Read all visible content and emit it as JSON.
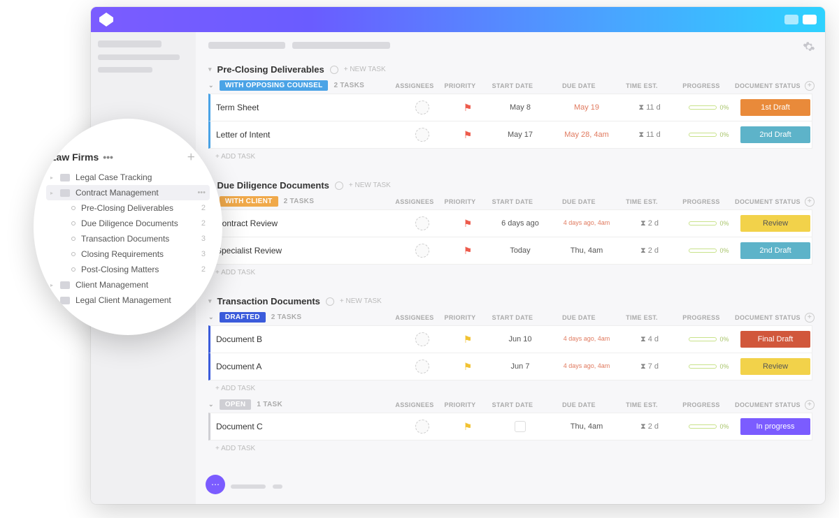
{
  "sidebar": {
    "space_name": "Law Firms",
    "folders": [
      {
        "name": "Legal Case Tracking"
      },
      {
        "name": "Contract Management",
        "active": true,
        "lists": [
          {
            "name": "Pre-Closing Deliverables",
            "count": 2
          },
          {
            "name": "Due Diligence Documents",
            "count": 2
          },
          {
            "name": "Transaction Documents",
            "count": 3
          },
          {
            "name": "Closing Requirements",
            "count": 3
          },
          {
            "name": "Post-Closing Matters",
            "count": 2
          }
        ]
      },
      {
        "name": "Client Management"
      },
      {
        "name": "Legal Client Management"
      }
    ]
  },
  "columns": [
    "ASSIGNEES",
    "PRIORITY",
    "START DATE",
    "DUE DATE",
    "TIME EST.",
    "PROGRESS",
    "DOCUMENT STATUS"
  ],
  "doc_status_colors": {
    "1st Draft": "#e98a3a",
    "2nd Draft": "#5db3c9",
    "Review": "#f2d24a",
    "Final Draft": "#d1573b",
    "In progress": "#7b5cff"
  },
  "sections": [
    {
      "title": "Pre-Closing Deliverables",
      "newtask": "+ NEW TASK",
      "groups": [
        {
          "status_label": "WITH OPPOSING COUNSEL",
          "status_color": "#4aa3e6",
          "task_count": "2 TASKS",
          "border_color": "#4aa3e6",
          "tasks": [
            {
              "name": "Term Sheet",
              "flag": "red",
              "start": "May 8",
              "due": "May 19",
              "due_warn": true,
              "est": "11 d",
              "progress": "0%",
              "doc": "1st Draft"
            },
            {
              "name": "Letter of Intent",
              "flag": "red",
              "start": "May 17",
              "due": "May 28, 4am",
              "due_warn": true,
              "est": "11 d",
              "progress": "0%",
              "doc": "2nd Draft"
            }
          ],
          "add": "+ ADD TASK"
        }
      ]
    },
    {
      "title": "Due Diligence Documents",
      "newtask": "+ NEW TASK",
      "groups": [
        {
          "status_label": "WITH CLIENT",
          "status_color": "#f0a94a",
          "task_count": "2 TASKS",
          "border_color": "#f0a94a",
          "tasks": [
            {
              "name": "Contract Review",
              "flag": "red",
              "start": "6 days ago",
              "due": "4 days ago, 4am",
              "due_warn": true,
              "due_small": true,
              "est": "2 d",
              "progress": "0%",
              "doc": "Review"
            },
            {
              "name": "Specialist Review",
              "flag": "red",
              "start": "Today",
              "due": "Thu, 4am",
              "est": "2 d",
              "progress": "0%",
              "doc": "2nd Draft"
            }
          ],
          "add": "+ ADD TASK"
        }
      ]
    },
    {
      "title": "Transaction Documents",
      "newtask": "+ NEW TASK",
      "groups": [
        {
          "status_label": "DRAFTED",
          "status_color": "#3b5bdb",
          "task_count": "2 TASKS",
          "border_color": "#3b5bdb",
          "tasks": [
            {
              "name": "Document B",
              "flag": "yellow",
              "start": "Jun 10",
              "due": "4 days ago, 4am",
              "due_warn": true,
              "due_small": true,
              "est": "4 d",
              "progress": "0%",
              "doc": "Final Draft"
            },
            {
              "name": "Document A",
              "flag": "yellow",
              "start": "Jun 7",
              "due": "4 days ago, 4am",
              "due_warn": true,
              "due_small": true,
              "est": "7 d",
              "progress": "0%",
              "doc": "Review"
            }
          ],
          "add": "+ ADD TASK"
        },
        {
          "status_label": "OPEN",
          "status_color": "#cfcfd4",
          "task_count": "1 TASK",
          "border_color": "#cfcfd4",
          "tasks": [
            {
              "name": "Document C",
              "flag": "yellow",
              "start": "",
              "start_ph": true,
              "due": "Thu, 4am",
              "est": "2 d",
              "progress": "0%",
              "doc": "In progress"
            }
          ],
          "add": "+ ADD TASK"
        }
      ]
    }
  ]
}
